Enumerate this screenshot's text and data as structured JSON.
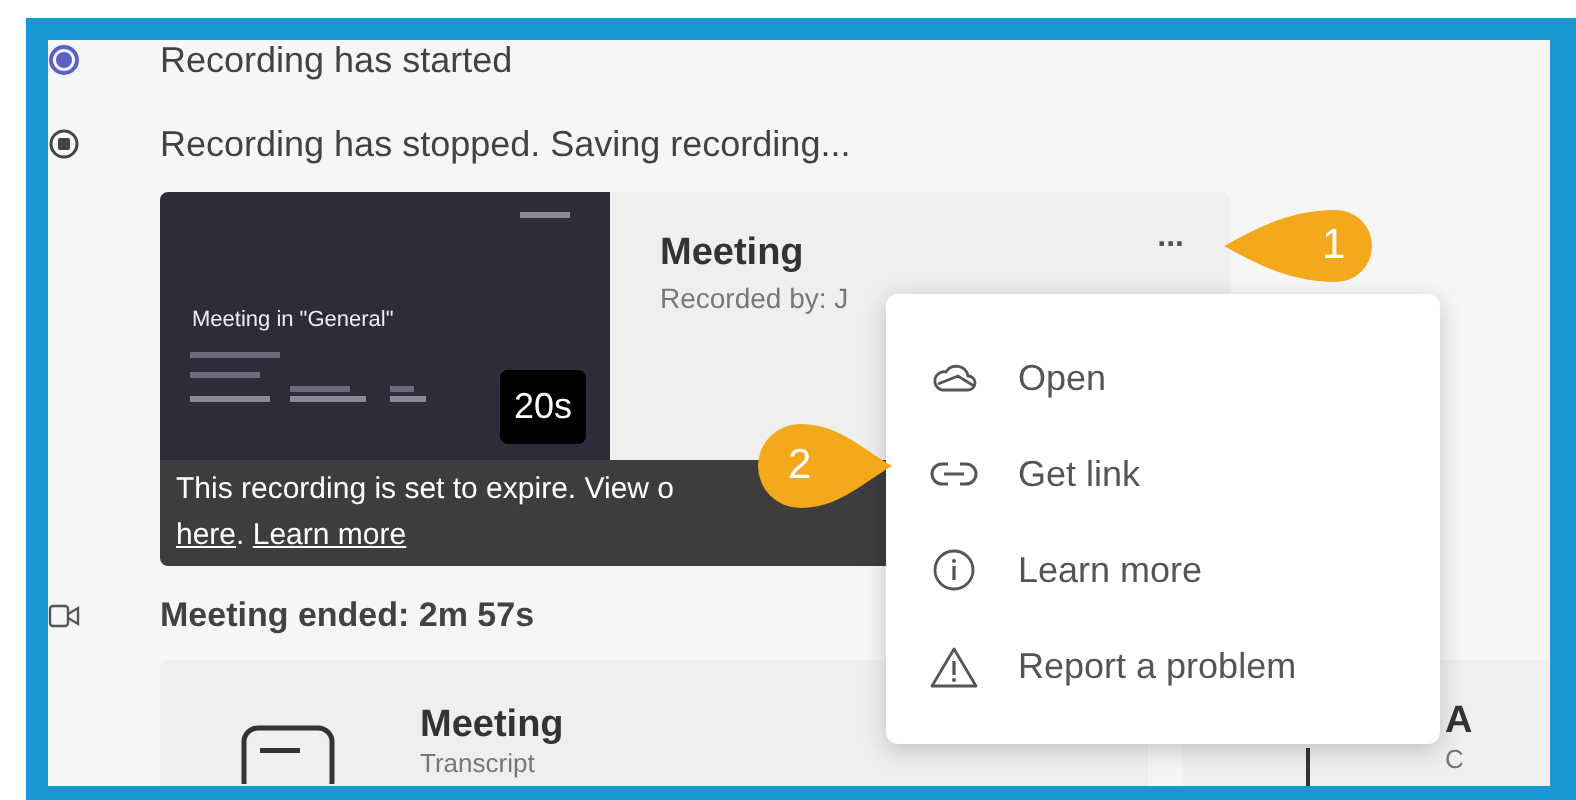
{
  "events_before": [
    {
      "kind": "started",
      "text": "Recording has started"
    },
    {
      "kind": "stopped",
      "text": "Recording has stopped. Saving recording..."
    }
  ],
  "recording_card": {
    "thumbnail_title": "Meeting in \"General\"",
    "duration": "20s",
    "title": "Meeting",
    "recorded_by": "Recorded by: J",
    "more": "...",
    "notice": "This recording is set to expire. View o",
    "notice_links": [
      "here",
      "Learn more"
    ],
    "notice_separator": ". "
  },
  "events_after": [
    {
      "kind": "ended",
      "text": "Meeting ended: 2m 57s"
    }
  ],
  "file_cards": [
    {
      "kind": "transcript",
      "title": "Meeting",
      "subtitle": "Transcript"
    },
    {
      "kind": "other",
      "title": "A",
      "subtitle": "C"
    }
  ],
  "context_menu": [
    {
      "kind": "open",
      "label": "Open"
    },
    {
      "kind": "link",
      "label": "Get link"
    },
    {
      "kind": "info",
      "label": "Learn more"
    },
    {
      "kind": "report",
      "label": "Report a problem"
    }
  ],
  "callouts": [
    {
      "number": "1"
    },
    {
      "number": "2"
    }
  ]
}
